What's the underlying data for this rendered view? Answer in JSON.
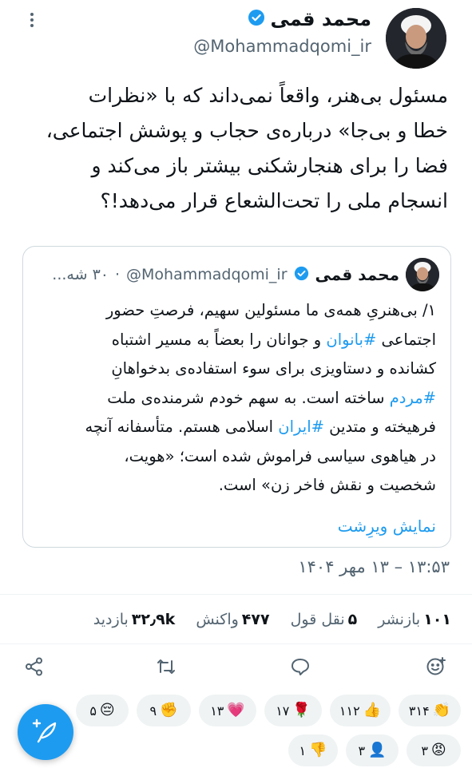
{
  "author": {
    "name": "محمد قمی",
    "handle": "@Mohammadqomi_ir"
  },
  "tweet": {
    "lines": [
      "مسئول بی‌هنر، واقعاً نمی‌داند که با «نظرات",
      "خطا و بی‌جا» درباره‌ی حجاب و پوشش اجتماعی،",
      "فضا را برای هنجارشکنی بیشتر باز می‌کند و",
      "انسجام ملی را تحت‌الشعاع قرار می‌دهد!؟"
    ]
  },
  "quote": {
    "name": "محمد قمی",
    "handle": "@Mohammadqomi_ir",
    "dot": "·",
    "date": "۳۰ شه...",
    "body": {
      "l1": "۱/ بی‌هنریِ همه‌ی ما مسئولین سهیم، فرصتِ حضور",
      "l2_pre": "اجتماعی ",
      "l2_tag": "#بانوان",
      "l2_post": " و جوانان را بعضاً به مسیر اشتباه",
      "l3": "کشانده و دستاویزی برای سوء استفاده‌ی بدخواهانِ",
      "l4_tag": "#مردم",
      "l4_post": " ساخته است. به سهم خودم شرمنده‌ی ملت",
      "l5_pre": "فرهیخته و متدین ",
      "l5_tag": "#ایران",
      "l5_post": " اسلامی هستم. متأسفانه آنچه",
      "l6": "در هیاهوی سیاسی فراموش شده است؛ «هویت،",
      "l7": "شخصیت و نقش فاخر زن» است."
    },
    "show_more": "نمایش ویرِشت"
  },
  "timestamp": "۱۳:۵۳ – ۱۳ مهر ۱۴۰۴",
  "stats": {
    "reposts_num": "۱۰۱",
    "reposts_label": "بازنشر",
    "quotes_num": "۵",
    "quotes_label": "نقل قول",
    "likes_num": "۴۷۷",
    "likes_label": "واکنش",
    "views_num": "۳۲٫۹k",
    "views_label": "بازدید"
  },
  "actions": [
    "add-reaction-icon",
    "reply-icon",
    "repost-icon",
    "share-icon"
  ],
  "reactions": [
    {
      "emoji": "👏",
      "count": "۳۱۴"
    },
    {
      "emoji": "👍",
      "count": "۱۱۲"
    },
    {
      "emoji": "🌹",
      "count": "۱۷"
    },
    {
      "emoji": "💗",
      "count": "۱۳"
    },
    {
      "emoji": "✊",
      "count": "۹"
    },
    {
      "emoji": "😔",
      "count": "۵"
    },
    {
      "emoji": "😡",
      "count": "۳"
    },
    {
      "emoji": "👤",
      "count": "۳"
    },
    {
      "emoji": "👎",
      "count": "۱"
    }
  ],
  "colors": {
    "accent": "#1d9bf0",
    "verified": "#1d9bf0",
    "secondary_text": "#536471",
    "chip_bg": "#eff3f4"
  }
}
